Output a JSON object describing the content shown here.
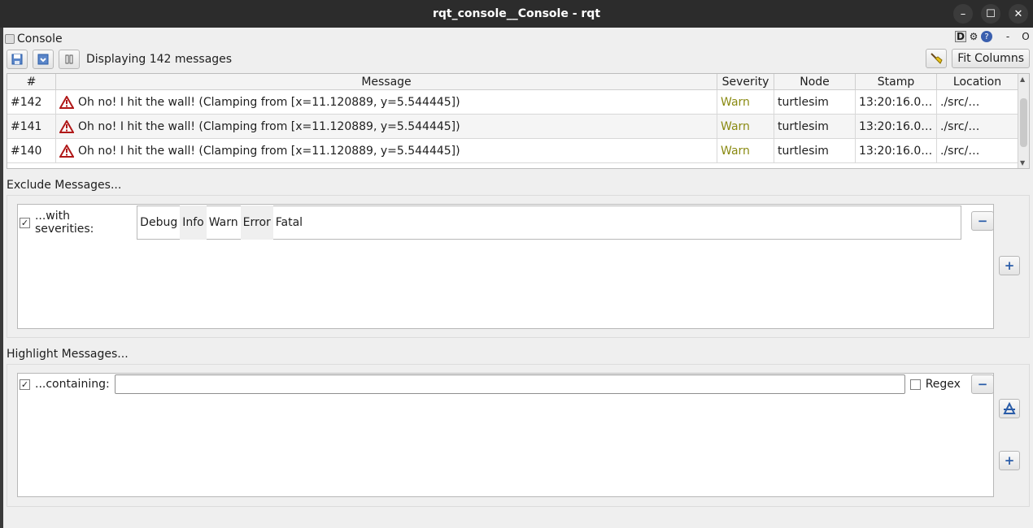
{
  "window": {
    "title": "rqt_console__Console - rqt"
  },
  "plugin": {
    "title": "Console",
    "d_label": "D",
    "help_label": "?",
    "dash_label": "-",
    "o_label": "O"
  },
  "toolbar": {
    "count_label": "Displaying 142 messages",
    "fit_label": "Fit Columns"
  },
  "table": {
    "headers": [
      "#",
      "Message",
      "Severity",
      "Node",
      "Stamp",
      "Location"
    ],
    "rows": [
      {
        "num": "#142",
        "message": "Oh no! I hit the wall! (Clamping from [x=11.120889, y=5.544445])",
        "severity": "Warn",
        "node": "turtlesim",
        "stamp": "13:20:16.0…",
        "location": "./src/…"
      },
      {
        "num": "#141",
        "message": "Oh no! I hit the wall! (Clamping from [x=11.120889, y=5.544445])",
        "severity": "Warn",
        "node": "turtlesim",
        "stamp": "13:20:16.0…",
        "location": "./src/…"
      },
      {
        "num": "#140",
        "message": "Oh no! I hit the wall! (Clamping from [x=11.120889, y=5.544445])",
        "severity": "Warn",
        "node": "turtlesim",
        "stamp": "13:20:16.0…",
        "location": "./src/…"
      }
    ]
  },
  "exclude": {
    "title": "Exclude Messages...",
    "checked_mark": "✓",
    "label": "...with severities:",
    "severities": [
      "Debug",
      "Info",
      "Warn",
      "Error",
      "Fatal"
    ],
    "minus": "−",
    "plus": "+"
  },
  "highlight": {
    "title": "Highlight Messages...",
    "checked_mark": "✓",
    "label": "...containing:",
    "input_value": "",
    "regex_label": "Regex",
    "minus": "−",
    "plus": "+"
  },
  "colors": {
    "warn": "#8a8a12",
    "titlebar": "#2c2c2c",
    "accent": "#2a5ca8"
  }
}
